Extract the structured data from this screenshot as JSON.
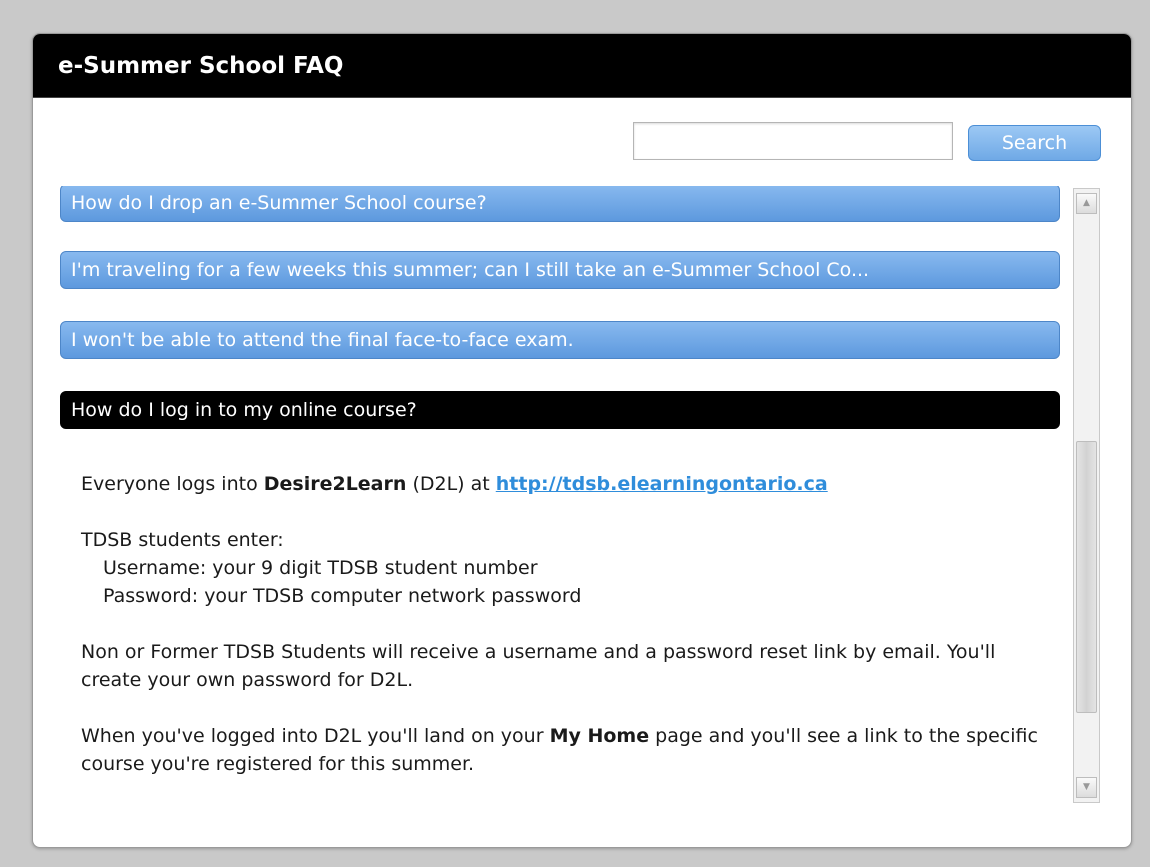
{
  "window": {
    "title": "e-Summer School FAQ"
  },
  "search": {
    "placeholder": "",
    "value": "",
    "button_label": "Search"
  },
  "faq": {
    "questions": [
      "How do I drop an e-Summer School course?",
      "I'm traveling for a few weeks this summer; can I still take an e-Summer School Co...",
      "I won't be able to attend the final face-to-face exam.",
      "How do I log in to my online course?"
    ],
    "answer": {
      "p1_before": "Everyone logs into ",
      "p1_bold": "Desire2Learn",
      "p1_after": " (D2L) at ",
      "p1_link": "http://tdsb.elearningontario.ca",
      "p2_heading": "TDSB students enter:",
      "p2_line1": "Username: your 9 digit TDSB student number",
      "p2_line2": "Password: your TDSB computer network password",
      "p3": "Non or Former TDSB Students will receive a username and a password reset link by email. You'll create your own password for D2L.",
      "p4_before": "When you've logged into D2L you'll land on your ",
      "p4_bold": "My Home",
      "p4_after": " page and you'll see a link to the specific course you're registered for this summer."
    }
  },
  "colors": {
    "accent_blue": "#6fa9e6",
    "titlebar": "#000000",
    "link": "#2f8ddb"
  },
  "icons": {
    "scroll_up": "▲",
    "scroll_down": "▼"
  }
}
